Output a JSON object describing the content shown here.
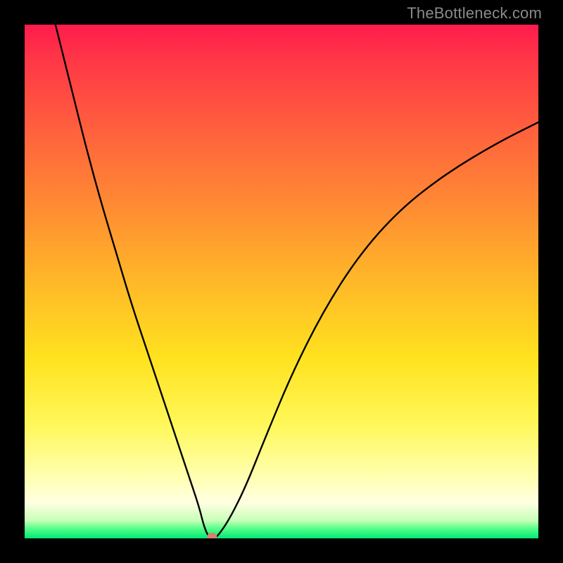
{
  "watermark": "TheBottleneck.com",
  "chart_data": {
    "type": "line",
    "title": "",
    "xlabel": "",
    "ylabel": "",
    "xlim": [
      0,
      100
    ],
    "ylim": [
      0,
      100
    ],
    "grid": false,
    "series": [
      {
        "name": "bottleneck-curve",
        "x": [
          6,
          8,
          10,
          12,
          15,
          18,
          21,
          24,
          27,
          30,
          32,
          34,
          35,
          36,
          37,
          38,
          40,
          43,
          47,
          52,
          58,
          65,
          73,
          82,
          92,
          100
        ],
        "values": [
          100,
          92,
          84,
          76,
          65,
          55,
          45,
          36,
          27,
          18,
          12,
          6,
          2,
          0,
          0,
          1,
          4,
          10,
          20,
          32,
          44,
          55,
          64,
          71,
          77,
          81
        ]
      }
    ],
    "marker": {
      "x": 36.5,
      "y": 0,
      "color": "#d88070"
    },
    "background": {
      "type": "vertical-gradient",
      "stops": [
        {
          "pos": 0.0,
          "color": "#ff1b4c"
        },
        {
          "pos": 0.2,
          "color": "#ff5f3e"
        },
        {
          "pos": 0.5,
          "color": "#ffb828"
        },
        {
          "pos": 0.78,
          "color": "#fff85a"
        },
        {
          "pos": 0.93,
          "color": "#ffffe2"
        },
        {
          "pos": 1.0,
          "color": "#00e874"
        }
      ]
    }
  }
}
